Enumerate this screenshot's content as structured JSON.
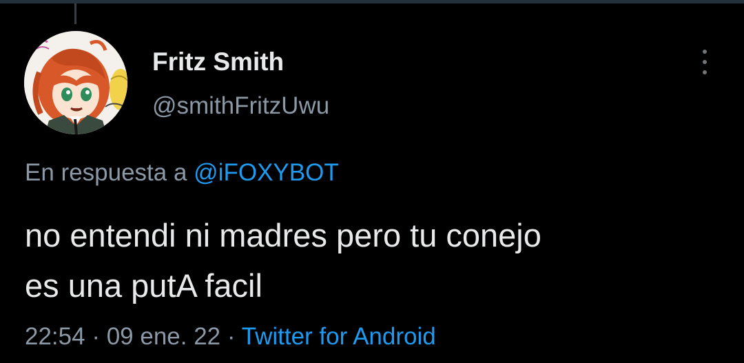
{
  "tweet": {
    "author": {
      "display_name": "Fritz Smith",
      "handle": "@smithFritzUwu",
      "avatar_icon": "anime-character-avatar"
    },
    "reply_prefix": "En respuesta a",
    "reply_to": "@iFOXYBOT",
    "text_line_1": "no entendi ni madres pero tu conejo",
    "text_line_2": "es una putA facil",
    "time": "22:54",
    "separator": "·",
    "date": "09 ene. 22",
    "source": "Twitter for Android",
    "more_icon": "more-vertical-icon"
  },
  "colors": {
    "background": "#000000",
    "primary_text": "#e7e9ea",
    "secondary_text": "#8b98a5",
    "link": "#1d9bf0"
  }
}
